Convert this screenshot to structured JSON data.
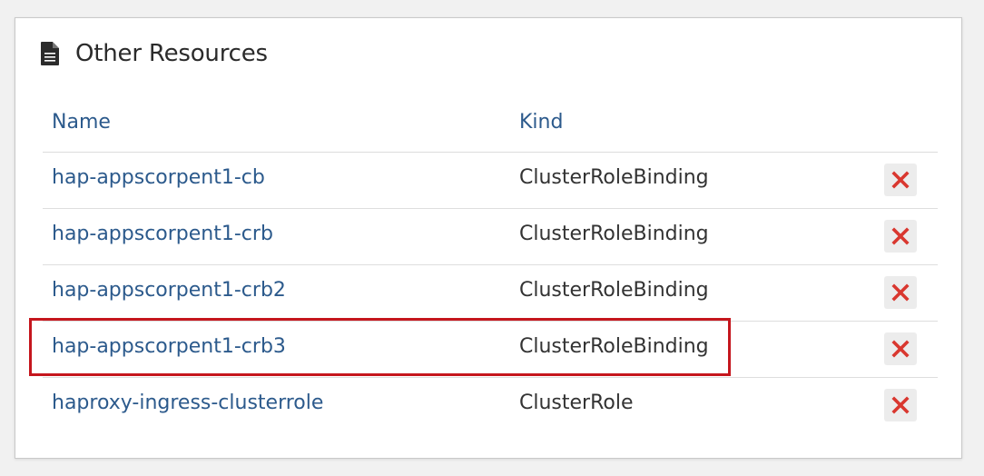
{
  "panel": {
    "title": "Other Resources",
    "title_icon": "document-icon"
  },
  "table": {
    "columns": [
      "Name",
      "Kind"
    ],
    "rows": [
      {
        "name": "hap-appscorpent1-cb",
        "kind": "ClusterRoleBinding",
        "action_icon": "delete-x-icon"
      },
      {
        "name": "hap-appscorpent1-crb",
        "kind": "ClusterRoleBinding",
        "action_icon": "delete-x-icon"
      },
      {
        "name": "hap-appscorpent1-crb2",
        "kind": "ClusterRoleBinding",
        "action_icon": "delete-x-icon"
      },
      {
        "name": "hap-appscorpent1-crb3",
        "kind": "ClusterRoleBinding",
        "action_icon": "delete-x-icon",
        "highlighted": true
      },
      {
        "name": "haproxy-ingress-clusterrole",
        "kind": "ClusterRole",
        "action_icon": "delete-x-icon"
      }
    ]
  },
  "colors": {
    "link": "#2c5a8c",
    "delete": "#d9372f",
    "highlight": "#c5161d"
  }
}
